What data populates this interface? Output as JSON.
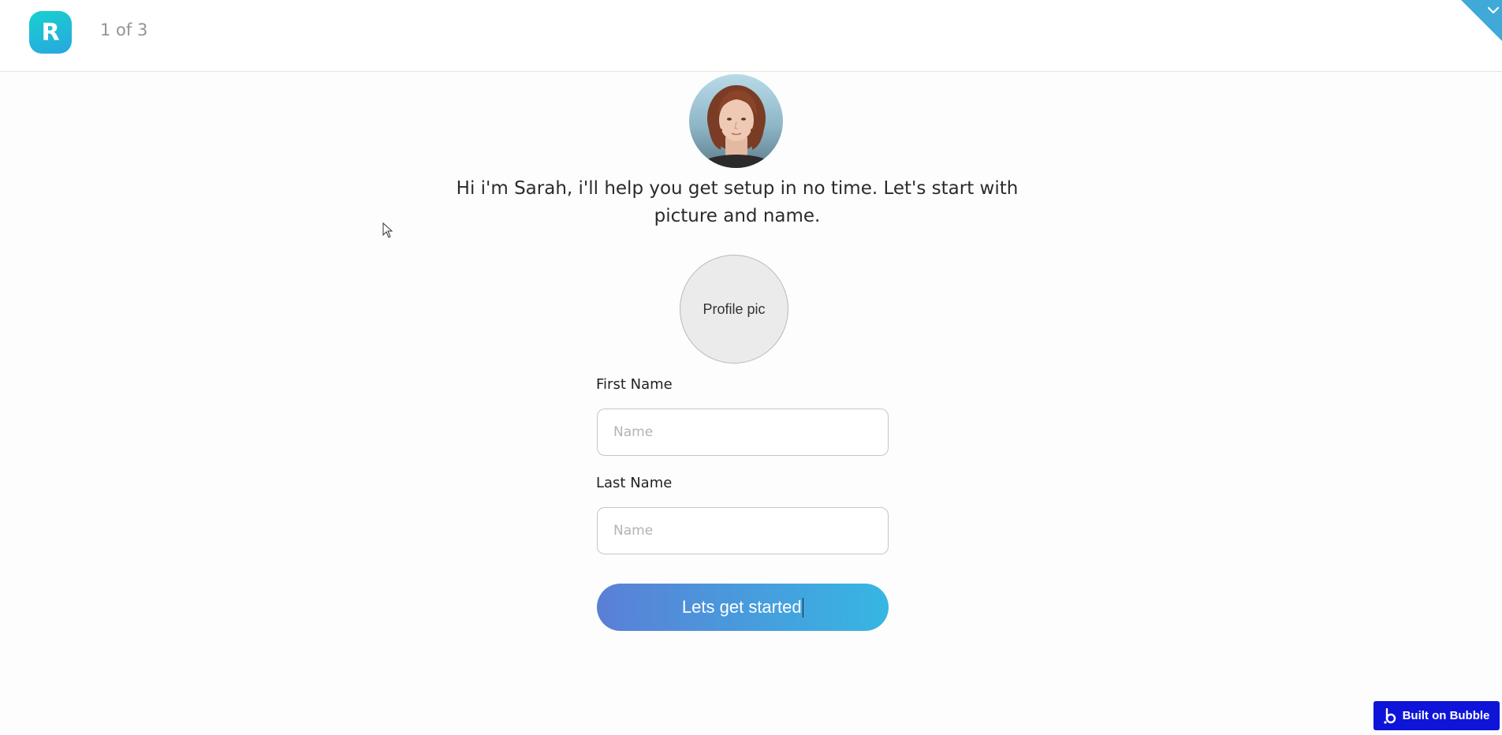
{
  "header": {
    "logo_letter": "R",
    "step_text": "1 of 3"
  },
  "intro": {
    "message": "Hi i'm Sarah, i'll help you get setup in no time. Let's start with picture and name."
  },
  "profile": {
    "label": "Profile pic"
  },
  "form": {
    "first_name_label": "First Name",
    "first_name_placeholder": "Name",
    "first_name_value": "",
    "last_name_label": "Last Name",
    "last_name_placeholder": "Name",
    "last_name_value": ""
  },
  "cta": {
    "label": "Lets get started"
  },
  "badge": {
    "label": "Built on Bubble"
  },
  "icons": {
    "corner": "chevron-down-icon",
    "badge": "bubble-logo-icon",
    "pointer": "mouse-pointer-icon"
  },
  "colors": {
    "logo_gradient_start": "#17d1cf",
    "logo_gradient_end": "#2aa6e0",
    "cta_gradient_start": "#5b7fd6",
    "cta_gradient_end": "#36b6e3",
    "corner": "#3fa9d8",
    "badge": "#0e14d8"
  }
}
